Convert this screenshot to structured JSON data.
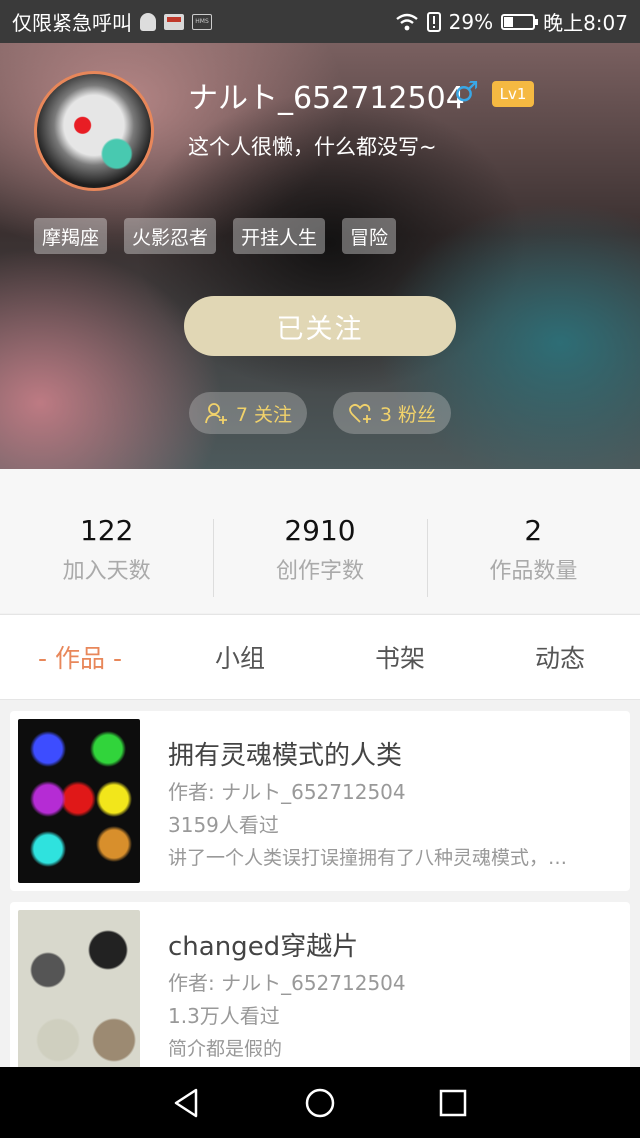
{
  "status_bar": {
    "carrier_text": "仅限紧急呼叫",
    "battery_percent": "29%",
    "time": "晚上8:07"
  },
  "profile": {
    "username": "ナルト_652712504",
    "gender_symbol": "♂",
    "level": "Lv1",
    "bio": "这个人很懒，什么都没写~",
    "tags": [
      "摩羯座",
      "火影忍者",
      "开挂人生",
      "冒险"
    ],
    "follow_button": "已关注",
    "following": "7 关注",
    "fans": "3 粉丝"
  },
  "stats": [
    {
      "value": "122",
      "label": "加入天数"
    },
    {
      "value": "2910",
      "label": "创作字数"
    },
    {
      "value": "2",
      "label": "作品数量"
    }
  ],
  "tabs": [
    {
      "label": "- 作品 -",
      "active": true
    },
    {
      "label": "小组",
      "active": false
    },
    {
      "label": "书架",
      "active": false
    },
    {
      "label": "动态",
      "active": false
    }
  ],
  "works": [
    {
      "title": "拥有灵魂模式的人类",
      "author": "作者: ナルト_652712504",
      "views": "3159人看过",
      "description": "讲了一个人类误打误撞拥有了八种灵魂模式，…"
    },
    {
      "title": "changed穿越片",
      "author": "作者: ナルト_652712504",
      "views": "1.3万人看过",
      "description": "简介都是假的"
    }
  ],
  "colors": {
    "accent": "#e8875a",
    "follow_button": "#e1d7b5",
    "level_badge": "#f5b942",
    "gender": "#39a7e6",
    "pill_text": "#f1d26b"
  }
}
